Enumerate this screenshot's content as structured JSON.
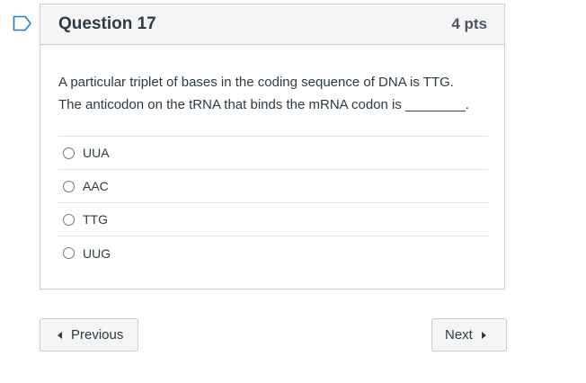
{
  "question": {
    "title": "Question 17",
    "points": "4 pts",
    "text_line1": "A particular triplet of bases in the coding sequence of DNA is TTG.",
    "text_line2": "The anticodon on the tRNA that binds the mRNA codon is ________.",
    "flag_icon": "flag-outline-icon",
    "answers": [
      {
        "label": "UUA",
        "selected": false
      },
      {
        "label": "AAC",
        "selected": false
      },
      {
        "label": "TTG",
        "selected": false
      },
      {
        "label": "UUG",
        "selected": false
      }
    ]
  },
  "navigation": {
    "previous_label": "Previous",
    "next_label": "Next"
  },
  "colors": {
    "flag": "#2b7abc",
    "header_bg": "#f5f5f5",
    "border": "#c7cdd1",
    "text": "#2d3b45"
  }
}
